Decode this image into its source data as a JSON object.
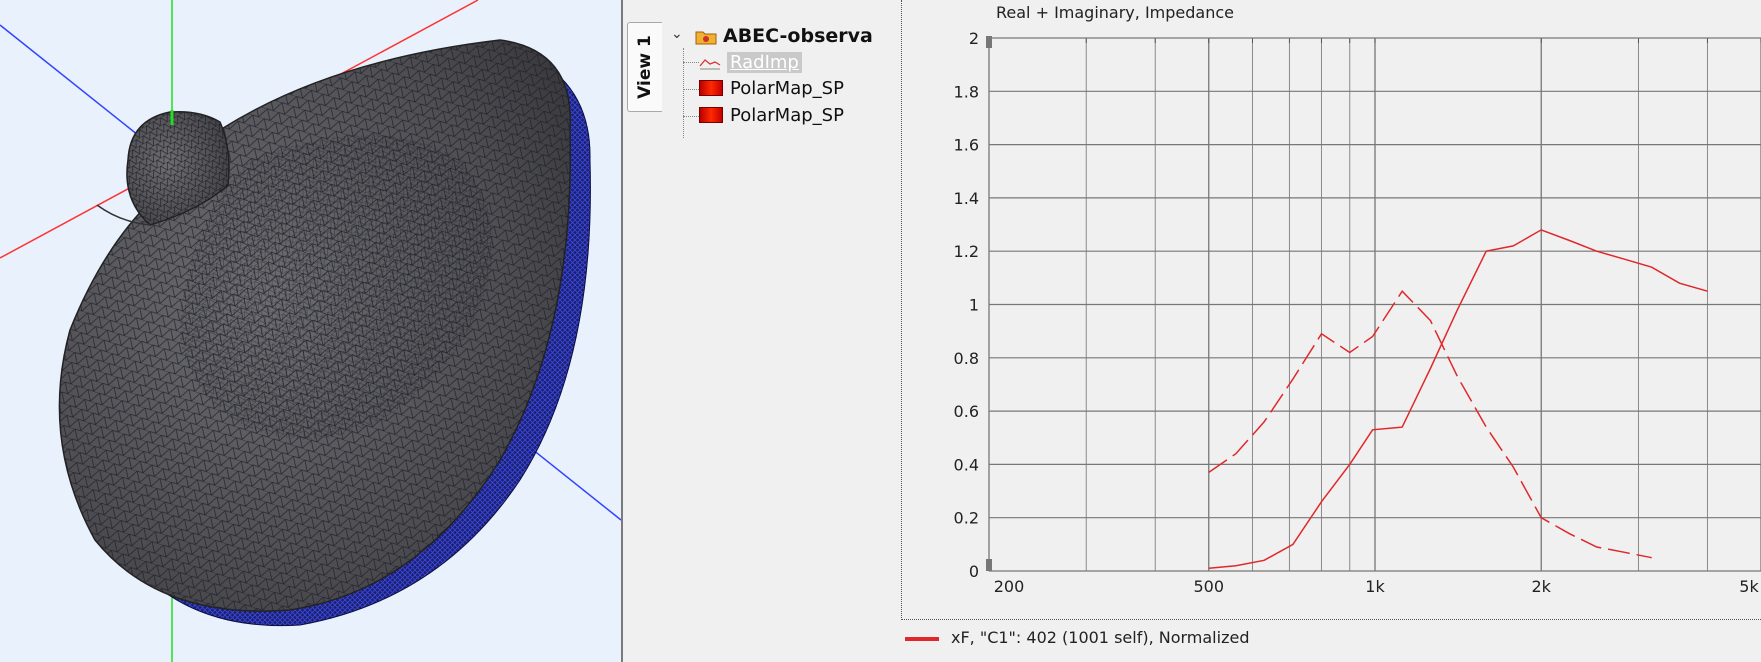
{
  "tree": {
    "tab_label": "View 1",
    "root_label": "ABEC-observa",
    "items": [
      {
        "label": "RadImp",
        "icon": "line-graph-icon",
        "selected": true
      },
      {
        "label": "PolarMap_SP",
        "icon": "polar-map-icon",
        "selected": false
      },
      {
        "label": "PolarMap_SP",
        "icon": "polar-map-icon",
        "selected": false
      }
    ]
  },
  "chart_data": {
    "type": "line",
    "title": "Real + Imaginary, Impedance",
    "xscale": "log",
    "xlim": [
      200,
      5000
    ],
    "ylim": [
      0,
      2
    ],
    "grid": true,
    "x_tick_labels": [
      "200",
      "500",
      "1k",
      "2k",
      "5k"
    ],
    "y_tick_labels": [
      "0",
      "0.2",
      "0.4",
      "0.6",
      "0.8",
      "1",
      "1.2",
      "1.4",
      "1.6",
      "1.8",
      "2"
    ],
    "legend_position": "bottom-left",
    "series": [
      {
        "name": "xF, \"C1\": 402 (1001 self), Normalized",
        "style": "solid",
        "color": "#e0282a",
        "points": [
          [
            500,
            0.01
          ],
          [
            560,
            0.02
          ],
          [
            630,
            0.04
          ],
          [
            710,
            0.1
          ],
          [
            800,
            0.26
          ],
          [
            900,
            0.4
          ],
          [
            990,
            0.53
          ],
          [
            1120,
            0.54
          ],
          [
            1260,
            0.76
          ],
          [
            1410,
            0.98
          ],
          [
            1590,
            1.2
          ],
          [
            1780,
            1.22
          ],
          [
            2000,
            1.28
          ],
          [
            2250,
            1.24
          ],
          [
            2520,
            1.2
          ],
          [
            2830,
            1.17
          ],
          [
            3170,
            1.14
          ],
          [
            3560,
            1.08
          ],
          [
            4000,
            1.05
          ]
        ]
      },
      {
        "name": "",
        "style": "dashed",
        "color": "#e0282a",
        "points": [
          [
            500,
            0.37
          ],
          [
            560,
            0.44
          ],
          [
            630,
            0.56
          ],
          [
            710,
            0.72
          ],
          [
            800,
            0.89
          ],
          [
            900,
            0.82
          ],
          [
            990,
            0.88
          ],
          [
            1120,
            1.05
          ],
          [
            1260,
            0.94
          ],
          [
            1410,
            0.73
          ],
          [
            1590,
            0.54
          ],
          [
            1780,
            0.39
          ],
          [
            2000,
            0.2
          ],
          [
            2250,
            0.14
          ],
          [
            2520,
            0.09
          ],
          [
            2830,
            0.07
          ],
          [
            3170,
            0.05
          ]
        ]
      }
    ]
  }
}
